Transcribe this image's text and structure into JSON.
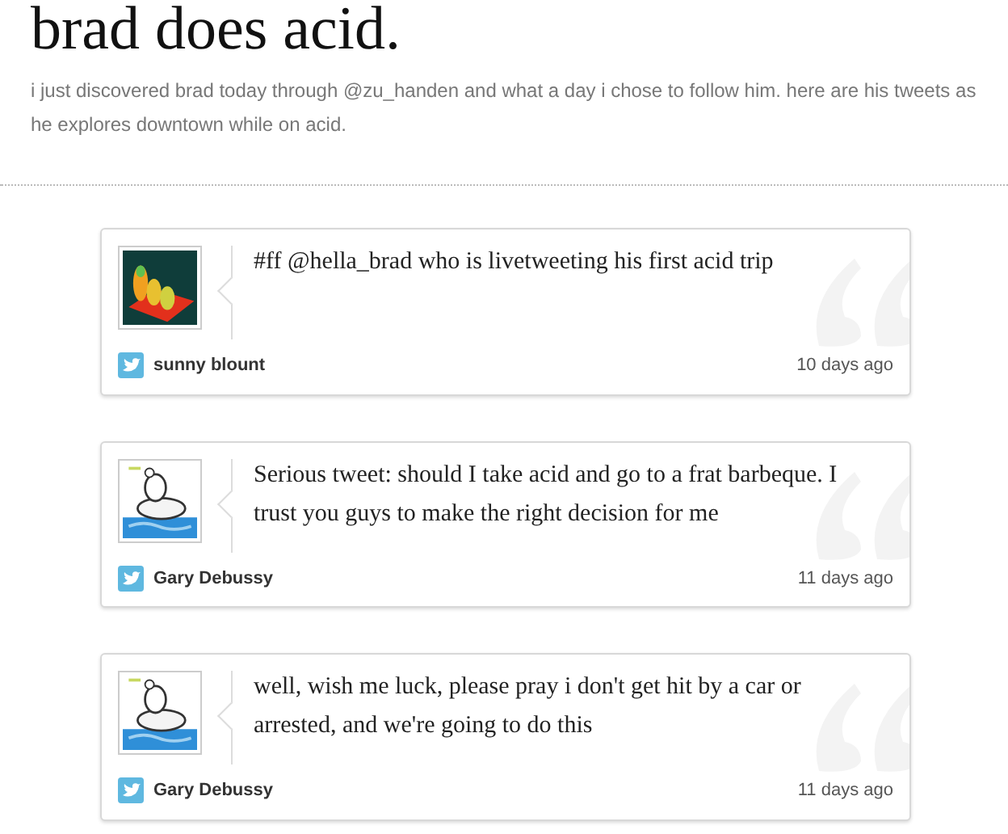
{
  "header": {
    "title": "brad does acid.",
    "description": "i just discovered brad today through @zu_handen and what a day i chose to follow him. here are his tweets as he explores downtown while on acid."
  },
  "tweets": [
    {
      "text": "#ff @hella_brad who is livetweeting his first acid trip",
      "author": "sunny blount",
      "time": "10 days ago"
    },
    {
      "text": "Serious tweet: should I take acid and go to a frat barbeque. I trust you guys to make the right decision for me",
      "author": "Gary Debussy",
      "time": "11 days ago"
    },
    {
      "text": "well, wish me luck, please pray i don't get hit by a car or arrested, and we're going to do this",
      "author": "Gary Debussy",
      "time": "11 days ago"
    }
  ]
}
